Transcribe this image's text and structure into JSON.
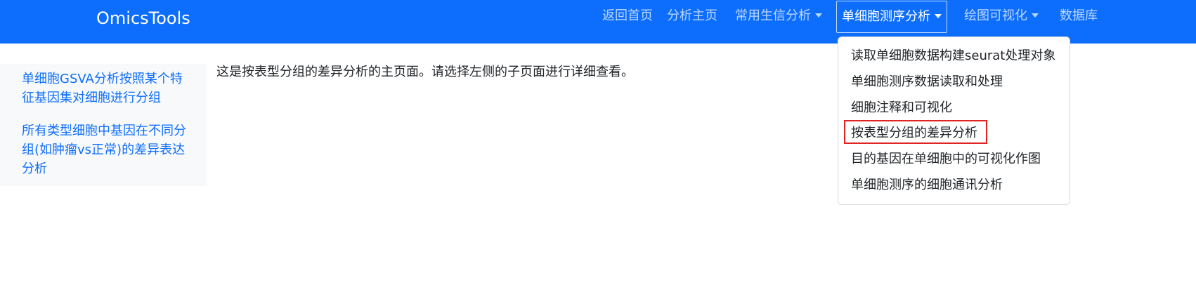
{
  "navbar": {
    "brand": "OmicsTools",
    "items": [
      {
        "label": "返回首页"
      },
      {
        "label": "分析主页"
      },
      {
        "label": "常用生信分析"
      },
      {
        "label": "单细胞测序分析"
      },
      {
        "label": "绘图可视化"
      },
      {
        "label": "数据库"
      }
    ]
  },
  "sidebar": {
    "links": [
      {
        "label": "单细胞GSVA分析按照某个特征基因集对细胞进行分组"
      },
      {
        "label": "所有类型细胞中基因在不同分组(如肿瘤vs正常)的差异表达分析"
      }
    ]
  },
  "main": {
    "text": "这是按表型分组的差异分析的主页面。请选择左侧的子页面进行详细查看。"
  },
  "dropdown": {
    "items": [
      {
        "label": "读取单细胞数据构建seurat处理对象"
      },
      {
        "label": "单细胞测序数据读取和处理"
      },
      {
        "label": "细胞注释和可视化"
      },
      {
        "label": "按表型分组的差异分析"
      },
      {
        "label": "目的基因在单细胞中的可视化作图"
      },
      {
        "label": "单细胞测序的细胞通讯分析"
      }
    ]
  },
  "colors": {
    "navbar_bg": "#0d6efd",
    "link": "#0d6efd",
    "highlight_box": "#e02424"
  }
}
